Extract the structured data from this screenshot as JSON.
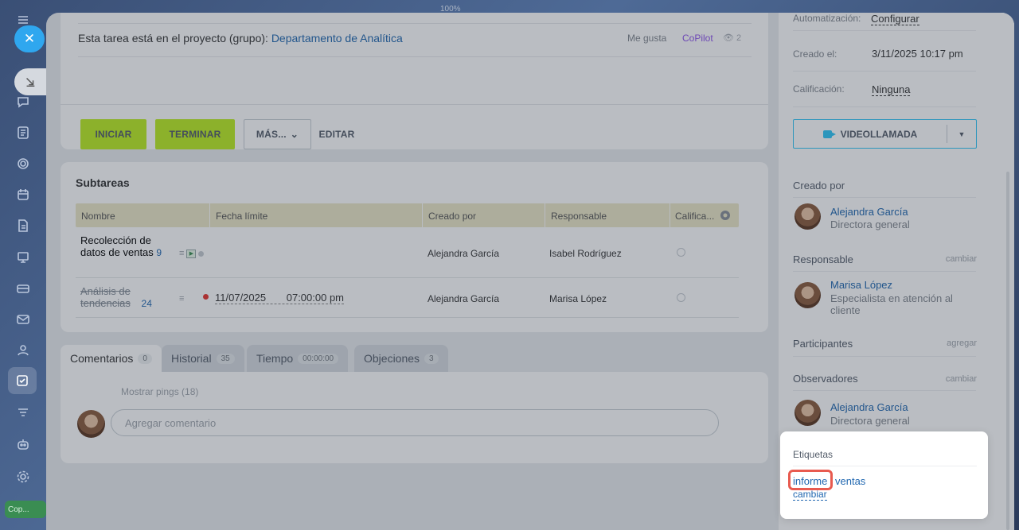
{
  "top_hint": "100%",
  "rail": {
    "bottom_label": "Cop..."
  },
  "task": {
    "project_label": "Esta tarea está en el proyecto (grupo):",
    "project_link": "Departamento de Analítica",
    "like": "Me gusta",
    "copilot": "CoPilot",
    "views": "2"
  },
  "buttons": {
    "start": "INICIAR",
    "finish": "TERMINAR",
    "more": "MÁS...",
    "edit": "EDITAR"
  },
  "subtasks": {
    "title": "Subtareas",
    "columns": [
      "Nombre",
      "Fecha límite",
      "Creado por",
      "Responsable",
      "Califica..."
    ],
    "rows": [
      {
        "name": "Recolección de datos de ventas",
        "count": "9",
        "deadline_date": "",
        "deadline_time": "",
        "creator": "Alejandra García",
        "responsible": "Isabel Rodríguez",
        "completed": false
      },
      {
        "name": "Análisis de tendencias",
        "count": "24",
        "deadline_date": "11/07/2025",
        "deadline_time": "07:00:00 pm",
        "creator": "Alejandra García",
        "responsible": "Marisa López",
        "completed": true
      }
    ]
  },
  "tabs": [
    {
      "label": "Comentarios",
      "badge": "0"
    },
    {
      "label": "Historial",
      "badge": "35"
    },
    {
      "label": "Tiempo",
      "badge": "00:00:00"
    },
    {
      "label": "Objeciones",
      "badge": "3"
    }
  ],
  "comments": {
    "pings": "Mostrar pings (18)",
    "placeholder": "Agregar comentario"
  },
  "sidebar": {
    "automation_label": "Automatización:",
    "automation_value": "Configurar",
    "created_label": "Creado el:",
    "created_value": "3/11/2025 10:17 pm",
    "rating_label": "Calificación:",
    "rating_value": "Ninguna",
    "video_call": "VIDEOLLAMADA",
    "created_by": {
      "title": "Creado por",
      "name": "Alejandra García",
      "role": "Directora general"
    },
    "responsible": {
      "title": "Responsable",
      "action": "cambiar",
      "name": "Marisa López",
      "role": "Especialista en atención al cliente"
    },
    "participants": {
      "title": "Participantes",
      "action": "agregar"
    },
    "observers": {
      "title": "Observadores",
      "action": "cambiar",
      "name": "Alejandra García",
      "role": "Directora general"
    }
  },
  "tags": {
    "title": "Etiquetas",
    "items": [
      "informe",
      "ventas"
    ],
    "change": "cambiar"
  }
}
